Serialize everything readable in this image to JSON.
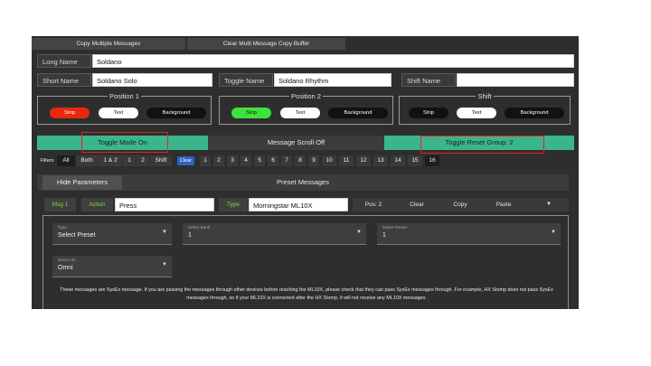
{
  "top_buttons": {
    "copy_multiple": "Copy Multiple Messages",
    "clear_buffer": "Clear Multi Message Copy Buffer"
  },
  "fields": {
    "long_name_label": "Long Name",
    "long_name_value": "Soldano",
    "short_name_label": "Short Name",
    "short_name_value": "Soldano Solo",
    "toggle_name_label": "Toggle Name",
    "toggle_name_value": "Soldano Rhythm",
    "shift_name_label": "Shift Name",
    "shift_name_value": ""
  },
  "groups": [
    {
      "title": "Position 1",
      "strip": "Strip",
      "text": "Text",
      "background": "Background",
      "strip_color": "#e8290f"
    },
    {
      "title": "Position 2",
      "strip": "Strip",
      "text": "Text",
      "background": "Background",
      "strip_color": "#3de33b"
    },
    {
      "title": "Shift",
      "strip": "Strip",
      "text": "Text",
      "background": "Background",
      "strip_color": "#111111"
    }
  ],
  "mode_bar": {
    "toggle_mode": "Toggle Mode On",
    "message_scroll": "Message Scroll Off",
    "toggle_reset_group": "Toggle Reset Group: 2"
  },
  "filters": {
    "label": "Filters",
    "options": [
      "All",
      "Both",
      "1 & 2",
      "1",
      "2",
      "Shift"
    ],
    "selected": "All",
    "clear": "Clear",
    "numbers": [
      "1",
      "2",
      "3",
      "4",
      "5",
      "6",
      "7",
      "8",
      "9",
      "10",
      "11",
      "12",
      "13",
      "14",
      "15",
      "16"
    ],
    "selected_number": "16"
  },
  "preset_header": {
    "hide_parameters": "Hide Parameters",
    "title": "Preset Messages"
  },
  "message_row": {
    "msg_label": "Msg 1",
    "action_label": "Action",
    "action_value": "Press",
    "type_label": "Type",
    "type_value": "Morningstar ML10X",
    "pos": "Pos: 2",
    "clear": "Clear",
    "copy": "Copy",
    "paste": "Paste",
    "dropdown_icon": "caret-down-icon"
  },
  "params": {
    "type": {
      "caption": "Type",
      "value": "Select Preset"
    },
    "select_bank": {
      "caption": "Select Bank",
      "value": "1"
    },
    "select_preset": {
      "caption": "Select Preset",
      "value": "1"
    },
    "device_id": {
      "caption": "Device ID",
      "value": "Omni"
    }
  },
  "note": "These messages are SysEx message. If you are passing the messages through other devices before reaching the ML10X, please check that they can pass SysEx messages through. For example, HX Stomp does not pass SysEx messages through, so if your ML10X is connected after the HX Stomp, it will not receive any ML10X messages.",
  "colors": {
    "accent_teal": "#3bb58e",
    "highlight_red": "#e52222",
    "msg_green": "#7bdc45"
  }
}
